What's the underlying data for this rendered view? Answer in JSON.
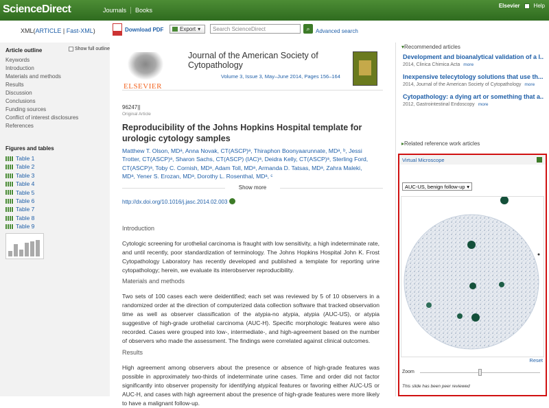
{
  "topbar": {
    "logo": "ScienceDirect",
    "nav": [
      "Journals",
      "Books"
    ],
    "user": "Elsevier",
    "help": "Help"
  },
  "toolbar": {
    "xml_prefix": "XML(",
    "xml_article": "ARTICLE",
    "xml_sep": " | ",
    "xml_fast": "Fast-XML",
    "xml_suffix": ")",
    "download_pdf": "Download PDF",
    "export": "Export",
    "search_placeholder": "Search ScienceDirect",
    "advanced_search": "Advanced search"
  },
  "outline": {
    "heading": "Article outline",
    "show_full": "Show full outline",
    "items": [
      "Keywords",
      "Introduction",
      "Materials and methods",
      "Results",
      "Discussion",
      "Conclusions",
      "Funding sources",
      "Conflict of interest disclosures",
      "References"
    ]
  },
  "figures": {
    "heading": "Figures and tables",
    "items": [
      "Table 1",
      "Table 2",
      "Table 3",
      "Table 4",
      "Table 5",
      "Table 6",
      "Table 7",
      "Table 8",
      "Table 9"
    ]
  },
  "journal": {
    "publisher": "ELSEVIER",
    "title": "Journal of the American Society of Cytopathology",
    "volume": "Volume 3, Issue 3, May–June 2014, Pages 156–164"
  },
  "article": {
    "id": "96247||",
    "type": "Original Article",
    "title": "Reproducibility of the Johns Hopkins Hospital template for urologic cytology samples",
    "authors": "Matthew T. Olson, MDᵃ, Anna Novak, CT(ASCP)ᵃ, Thiraphon Boonyaarunnate, MDᵃ, ᵇ, Jessi Trotter, CT(ASCP)ᵃ, Sharon Sachs, CT(ASCP) (IAC)ᵃ, Deidra Kelly, CT(ASCP)ᵃ, Sterling Ford, CT(ASCP)ᵃ, Toby C. Cornish, MDᵃ, Adam Toll, MDᵃ, Armanda D. Tatsas, MDᵃ, Zahra Maleki, MDᵃ, Yener S. Erozan, MDᵃ, Dorothy L. Rosenthal, MDᵃ, ᶜ",
    "show_more": "Show more",
    "doi": "http://dx.doi.org/10.1016/j.jasc.2014.02.003"
  },
  "sections": [
    {
      "heading": "Introduction",
      "text": "Cytologic screening for urothelial carcinoma is fraught with low sensitivity, a high indeterminate rate, and until recently, poor standardization of terminology. The Johns Hopkins Hospital John K. Frost Cytopathology Laboratory has recently developed and published a template for reporting urine cytopathology; herein, we evaluate its interobserver reproducibility."
    },
    {
      "heading": "Materials and methods",
      "text": "Two sets of 100 cases each were deidentified; each set was reviewed by 5 of 10 observers in a randomized order at the direction of computerized data collection software that tracked observation time as well as observer classification of the atypia-no atypia, atypia (AUC-US), or atypia suggestive of high-grade urothelial carcinoma (AUC-H). Specific morphologic features were also recorded. Cases were grouped into low-, intermediate-, and high-agreement based on the number of observers who made the assessment. The findings were correlated against clinical outcomes."
    },
    {
      "heading": "Results",
      "text": "High agreement among observers about the presence or absence of high-grade features was possible in approximately two-thirds of indeterminate urine cases. Time and order did not factor significantly into observer propensity for identifying atypical features or favoring either AUC-US or AUC-H, and cases with high agreement about the presence of high-grade features were more likely to have a malignant follow-up."
    }
  ],
  "recommended": {
    "heading": "Recommended articles",
    "more": "more",
    "items": [
      {
        "title": "Development and bioanalytical validation of a l...",
        "meta": "2014, Clinica Chimica Acta"
      },
      {
        "title": "Inexpensive telecytology solutions that use th...",
        "meta": "2014, Journal of the American Society of Cytopathology"
      },
      {
        "title": "Cytopathology: a dying art or something that a...",
        "meta": "2012, Gastrointestinal Endoscopy"
      }
    ]
  },
  "related": {
    "heading": "Related reference work articles"
  },
  "virtual_microscope": {
    "heading": "Virtual Microscope",
    "selected": "AUC-US, benign follow-up",
    "reset": "Reset",
    "zoom_label": "Zoom",
    "zoom_level": 0.5,
    "note": "This slide has been peer reviewed"
  }
}
